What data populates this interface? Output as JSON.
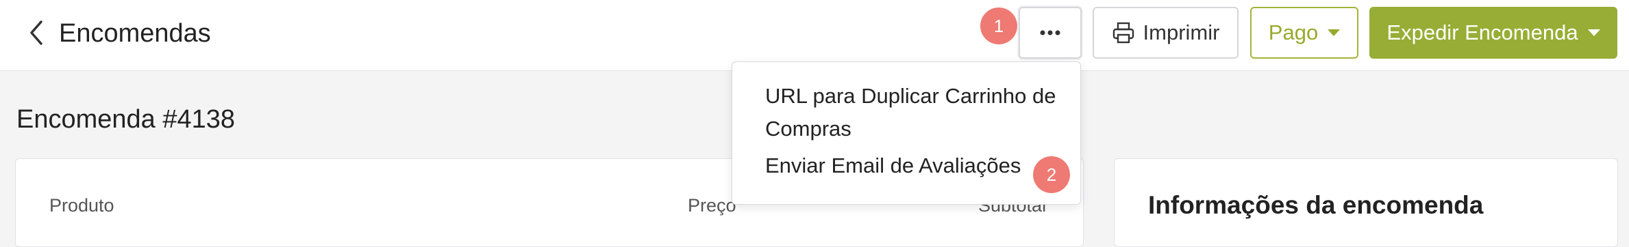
{
  "header": {
    "title": "Encomendas",
    "more_label": "···",
    "print_label": "Imprimir",
    "paid_label": "Pago",
    "ship_label": "Expedir Encomenda"
  },
  "badges": {
    "first": "1",
    "second": "2"
  },
  "dropdown": {
    "items": [
      "URL para Duplicar Carrinho de Compras",
      "Enviar Email de Avaliações"
    ]
  },
  "order": {
    "title": "Encomenda #4138",
    "columns": [
      "Produto",
      "Preço",
      "Subtotal"
    ]
  },
  "info_panel": {
    "title": "Informações da encomenda"
  },
  "colors": {
    "accent": "#98ad35",
    "badge": "#ee7a73"
  }
}
